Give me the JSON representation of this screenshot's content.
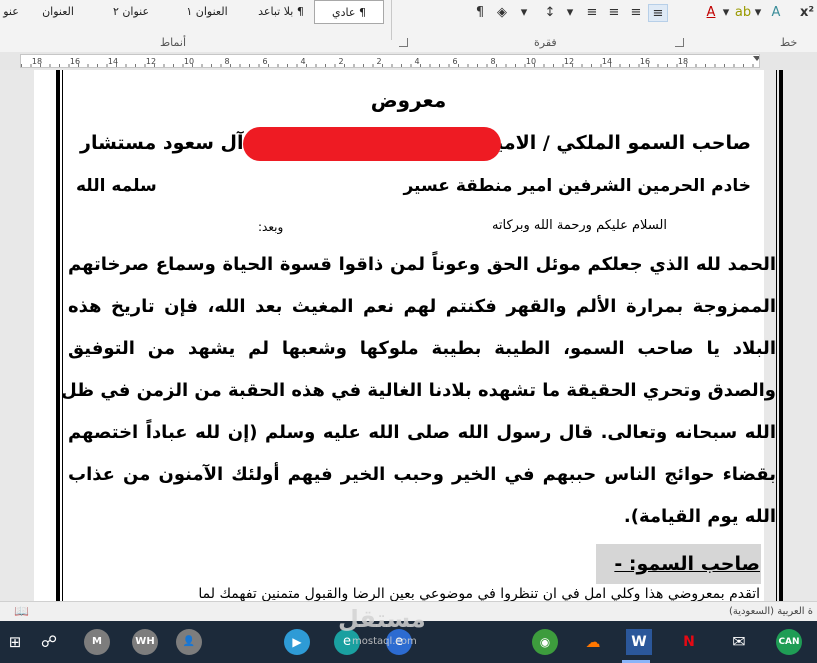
{
  "ribbon": {
    "styles": [
      "عنو",
      "العنوان",
      "عنوان ٢",
      "العنوان ١",
      "¶ بلا تباعد",
      "¶ عادي"
    ],
    "selected_style": "¶ عادي",
    "groups": {
      "styles": "أنماط",
      "paragraph": "فقرة",
      "font": "خط"
    }
  },
  "ruler": {
    "numbers": [
      "18",
      "16",
      "14",
      "12",
      "10",
      "8",
      "6",
      "4",
      "2",
      "2",
      "4",
      "6",
      "8",
      "10",
      "12",
      "14",
      "16",
      "18"
    ]
  },
  "document": {
    "title": "معروض",
    "address_line1_right": "صاحب السمو الملكي / الامير",
    "address_line1_left": "آل سعود مستشار",
    "address_line2_right": "خادم الحرمين الشرفين امير منطقة عسير",
    "address_line2_left": "سلمه الله",
    "greeting": "السلام عليكم ورحمة الله وبركاته",
    "greeting_after": "وبعد:",
    "body_lines": [
      "الحمد لله الذي جعلكم موئل الحق وعوناً لمن ذاقوا قسوة الحياة وسماع صرخاتهم",
      "الممزوجة بمرارة الألم والقهر فكنتم لهم نعم المغيث بعد الله، فإن تاريخ هذه",
      "البلاد يا صاحب السمو، الطيبة بطيبة ملوكها وشعبها لم يشهد من التوفيق",
      "والصدق وتحري الحقيقة ما تشهده بلادنا الغالية في هذه الحقبة من الزمن في ظل",
      "الله سبحانه وتعالى. قال رسول الله صلى الله عليه وسلم (إن لله عباداً اختصهم",
      "بقضاء حوائج الناس حببهم في الخير وحبب الخير فيهم أولئك الآمنون من عذاب",
      "الله يوم القيامة)."
    ],
    "section_heading": "صاحب السمو: -",
    "cut_line": "اتقدم بمعروضي هذا وكلي امل في ان تنظروا في موضوعي بعين الرضا والقبول متمنين تفهمك لما"
  },
  "status_bar": {
    "language": "ة العربية (السعودية)"
  },
  "taskbar": {
    "avatars": [
      "M",
      "WH"
    ],
    "items": [
      "windows-icon",
      "people-icon",
      "avatar-m",
      "avatar-wh",
      "avatar-generic",
      "video-app-icon",
      "edge-icon",
      "edge-canary-icon",
      "chrome-icon",
      "soundcloud-icon",
      "word-icon",
      "netflix-icon",
      "mail-icon",
      "edge-can-icon"
    ],
    "colors": {
      "word": "#2b579a",
      "netflix": "#e50914",
      "soundcloud": "#ff7700",
      "taskbar_bg": "#1c2a3a",
      "redaction": "#ee1b23"
    }
  },
  "watermark": {
    "text": "مستقل",
    "sub": "mostaql.com"
  }
}
